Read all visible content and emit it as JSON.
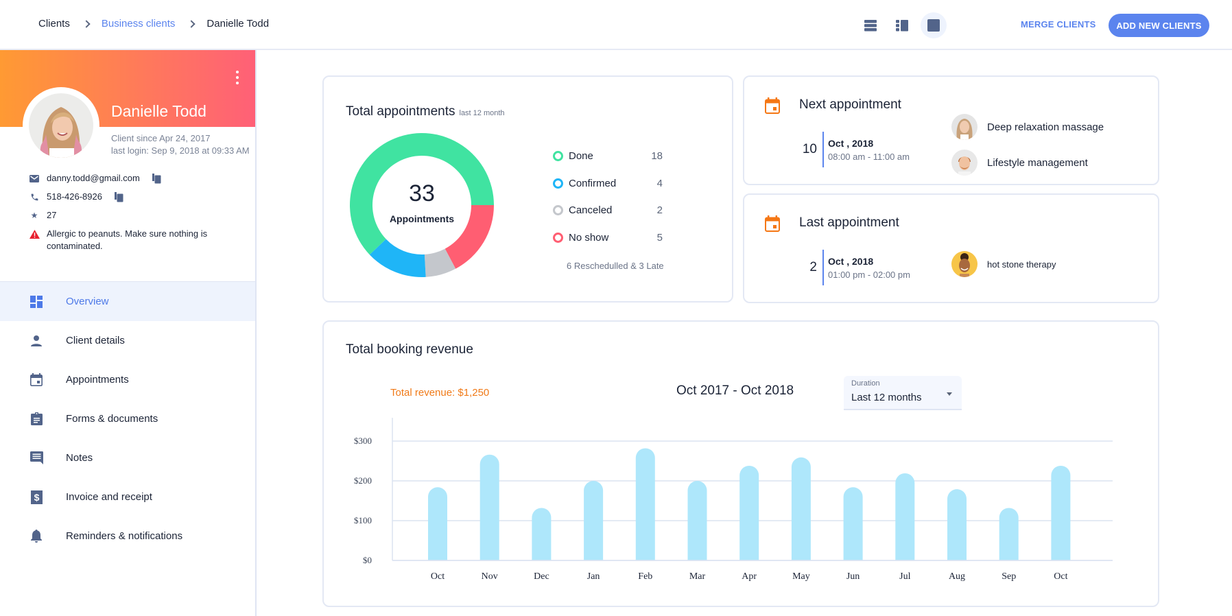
{
  "header": {
    "breadcrumb": [
      "Clients",
      "Business clients",
      "Danielle Todd"
    ],
    "view_icons": [
      "list-view-icon",
      "split-view-icon",
      "single-view-icon"
    ],
    "active_view": "single-view-icon",
    "merge_label": "MERGE CLIENTS",
    "add_label": "ADD NEW CLIENTS"
  },
  "client": {
    "name": "Danielle Todd",
    "since": "Client since Apr 24, 2017",
    "last_login": "last login: Sep 9, 2018 at 09:33 AM",
    "email": "danny.todd@gmail.com",
    "phone": "518-426-8926",
    "points": "27",
    "alert": "Allergic to peanuts. Make sure nothing is contaminated."
  },
  "nav": [
    {
      "label": "Overview",
      "icon": "dashboard-icon",
      "active": true
    },
    {
      "label": "Client details",
      "icon": "person-icon"
    },
    {
      "label": "Appointments",
      "icon": "calendar-icon"
    },
    {
      "label": "Forms & documents",
      "icon": "clipboard-icon"
    },
    {
      "label": "Notes",
      "icon": "comment-icon"
    },
    {
      "label": "Invoice and receipt",
      "icon": "receipt-dollar-icon"
    },
    {
      "label": "Reminders & notifications",
      "icon": "bell-icon"
    }
  ],
  "appointments": {
    "title": "Total appointments",
    "subtitle": "last 12 month",
    "total": "33",
    "total_label": "Appointments",
    "note": "6 Reschedulled & 3 Late"
  },
  "next_appointment": {
    "title": "Next appointment",
    "day": "10",
    "month_year": "Oct , 2018",
    "time": "08:00 am - 11:00 am",
    "services": [
      "Deep relaxation massage",
      "Lifestyle management"
    ]
  },
  "last_appointment": {
    "title": "Last appointment",
    "day": "2",
    "month_year": "Oct , 2018",
    "time": "01:00 pm - 02:00 pm",
    "services": [
      "hot stone therapy"
    ]
  },
  "revenue": {
    "title": "Total booking revenue",
    "total": "Total revenue: $1,250",
    "range": "Oct 2017 - Oct 2018",
    "duration_label": "Duration",
    "duration_value": "Last 12 months"
  },
  "colors": {
    "accent": "#5b84ee",
    "done": "#40e3a1",
    "confirmed": "#1fb5f7",
    "canceled": "#c4c7cc",
    "no_show": "#ff5e72",
    "bar": "#aee7fb",
    "revenue_text": "#f07a18",
    "calendar_icon": "#f57714"
  },
  "chart_data": [
    {
      "type": "pie",
      "title": "Total appointments",
      "subtitle": "last 12 month",
      "center_value": 33,
      "center_label": "Appointments",
      "categories": [
        "Done",
        "Confirmed",
        "Canceled",
        "No show"
      ],
      "values": [
        18,
        4,
        2,
        5
      ],
      "colors": [
        "#40e3a1",
        "#1fb5f7",
        "#c4c7cc",
        "#ff5e72"
      ],
      "legend": "right"
    },
    {
      "type": "bar",
      "title": "Total booking revenue",
      "categories": [
        "Oct",
        "Nov",
        "Dec",
        "Jan",
        "Feb",
        "Mar",
        "Apr",
        "May",
        "Jun",
        "Jul",
        "Aug",
        "Sep",
        "Oct"
      ],
      "values": [
        184,
        266,
        132,
        200,
        282,
        200,
        238,
        259,
        184,
        219,
        179,
        132,
        238
      ],
      "yticks": [
        "$0",
        "$100",
        "$200",
        "$300"
      ],
      "ytick_values": [
        0,
        100,
        200,
        300
      ],
      "ylim": [
        0,
        300
      ],
      "grid": true,
      "xlabel": "",
      "ylabel": ""
    }
  ]
}
